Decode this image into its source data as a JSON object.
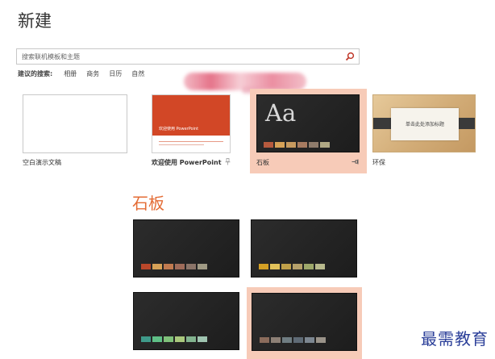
{
  "page": {
    "title": "新建"
  },
  "search": {
    "placeholder": "搜索联机模板和主题"
  },
  "suggestions": {
    "lead": "建议的搜索:",
    "items": [
      "相册",
      "商务",
      "日历",
      "自然"
    ]
  },
  "templates": [
    {
      "label": "空白演示文稿"
    },
    {
      "label": "欢迎使用 PowerPoint",
      "thumb_text": "欢迎使用 PowerPoint"
    },
    {
      "label": "石板",
      "thumb_text": "Aa"
    },
    {
      "label": "环保",
      "thumb_text": "单击此处添加标题"
    }
  ],
  "theme_preview": {
    "title": "石板",
    "variants": [
      {
        "swatches": [
          "#b9472a",
          "#d7a257",
          "#c17a4f",
          "#9f6b59",
          "#8b7468",
          "#a09a84"
        ]
      },
      {
        "swatches": [
          "#d4a024",
          "#e2c25a",
          "#c0a049",
          "#b6a16a",
          "#9ea86a",
          "#b8b98c"
        ]
      },
      {
        "swatches": [
          "#3f9a8a",
          "#5fbf86",
          "#7fc17a",
          "#a9c87d",
          "#82b38e",
          "#9fc4b0"
        ]
      },
      {
        "swatches": [
          "#8b6c5c",
          "#8d8076",
          "#6f7d82",
          "#5f6b76",
          "#7c8690",
          "#9a9389"
        ]
      }
    ]
  },
  "colors": {
    "accent": "#e46c35",
    "selection_highlight": "#f7cbb8",
    "slate_background": "#232323"
  },
  "slate_thumb_swatches": [
    "#b65a3e",
    "#d7a257",
    "#c79a5f",
    "#a77b60",
    "#8f7c6c",
    "#b0a884"
  ],
  "watermark": "最需教育"
}
